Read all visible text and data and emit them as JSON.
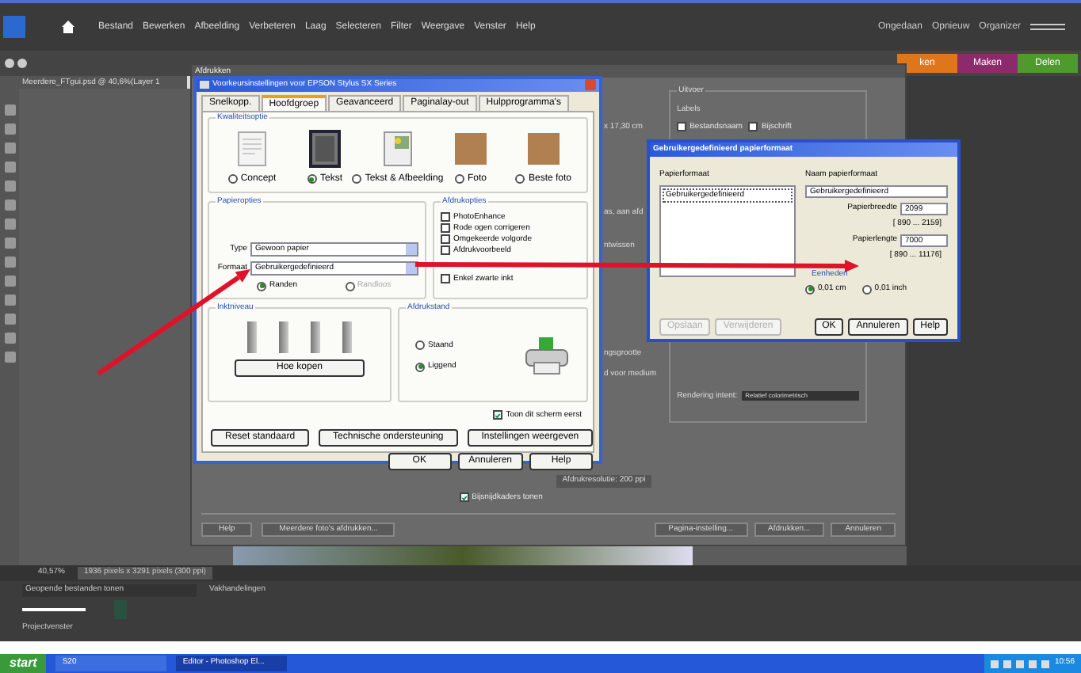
{
  "menu_bar": {
    "items": [
      "Bestand",
      "Bewerken",
      "Afbeelding",
      "Verbeteren",
      "Laag",
      "Selecteren",
      "Filter",
      "Weergave",
      "Venster",
      "Help"
    ],
    "right_buttons": [
      "Ongedaan",
      "Opnieuw",
      "Organizer"
    ]
  },
  "document_tab": "Meerdere_FTgui.psd @ 40,6%(Layer 1",
  "panel_tabs": [
    {
      "label": "ken",
      "color": "#e0761c"
    },
    {
      "label": "Maken",
      "color": "#8c2a6c"
    },
    {
      "label": "Delen",
      "color": "#4f9a2c"
    }
  ],
  "print_dialog": {
    "title": "Afdrukken",
    "cut_labels": [
      "x 17,30 cm",
      "as, aan afd",
      "ntwissen",
      "ngsgrootte",
      "d voor medium"
    ],
    "resolution": "Afdrukresolutie: 200 ppi",
    "crop_marks": {
      "label": "Bijsnijdkaders tonen",
      "checked": true
    },
    "output": {
      "title": "Uitvoer",
      "labels_title": "Labels",
      "options": [
        {
          "label": "Bestandsnaam",
          "checked": false
        },
        {
          "label": "Bijschrift",
          "checked": false
        }
      ],
      "rendering_label": "Rendering intent:",
      "rendering_value": "Relatief colorimetrisch"
    },
    "buttons_left": [
      "Help",
      "Meerdere foto's afdrukken..."
    ],
    "buttons_right": [
      "Pagina-instelling...",
      "Afdrukken...",
      "Annuleren"
    ]
  },
  "printer_dialog": {
    "title": "Voorkeursinstellingen voor EPSON Stylus SX Series",
    "tabs": [
      {
        "label": "Snelkopp.",
        "selected": false
      },
      {
        "label": "Hoofdgroep",
        "selected": true
      },
      {
        "label": "Geavanceerd",
        "selected": false
      },
      {
        "label": "Paginalay-out",
        "selected": false
      },
      {
        "label": "Hulpprogramma's",
        "selected": false
      }
    ],
    "quality": {
      "title": "Kwaliteitsoptie",
      "options": [
        {
          "label": "Concept",
          "kind": "document",
          "selected": false
        },
        {
          "label": "Tekst",
          "kind": "text",
          "selected": true
        },
        {
          "label": "Tekst & Afbeelding",
          "kind": "mixed",
          "selected": false
        },
        {
          "label": "Foto",
          "kind": "photo",
          "selected": false
        },
        {
          "label": "Beste foto",
          "kind": "photo",
          "selected": false
        }
      ]
    },
    "paper": {
      "title": "Papieropties",
      "type_label": "Type",
      "type_value": "Gewoon papier",
      "size_label": "Formaat",
      "size_value": "Gebruikergedefinieerd",
      "borders": [
        {
          "label": "Randen",
          "selected": true,
          "disabled": false
        },
        {
          "label": "Randloos",
          "selected": false,
          "disabled": true
        }
      ]
    },
    "print_options": {
      "title": "Afdrukopties",
      "options": [
        {
          "label": "PhotoEnhance",
          "checked": false
        },
        {
          "label": "Rode ogen corrigeren",
          "checked": false
        },
        {
          "label": "Omgekeerde volgorde",
          "checked": false
        },
        {
          "label": "Afdrukvoorbeeld",
          "checked": false
        },
        {
          "label": "Enkel zwarte inkt",
          "checked": false
        }
      ]
    },
    "ink": {
      "title": "Inktniveau",
      "buy_button": "Hoe kopen"
    },
    "orientation": {
      "title": "Afdrukstand",
      "options": [
        {
          "label": "Staand",
          "selected": false
        },
        {
          "label": "Liggend",
          "selected": true
        }
      ]
    },
    "show_first": {
      "label": "Toon dit scherm eerst",
      "checked": true
    },
    "buttons_row": [
      "Reset standaard",
      "Technische ondersteuning",
      "Instellingen weergeven"
    ],
    "footer_buttons": [
      "OK",
      "Annuleren",
      "Help"
    ]
  },
  "paper_dialog": {
    "title": "Gebruikergedefinieerd papierformaat",
    "list_label": "Papierformaat",
    "list_items": [
      {
        "label": "Gebruikergedefinieerd",
        "selected": true
      }
    ],
    "name_label": "Naam papierformaat",
    "name_value": "Gebruikergedefinieerd",
    "width": {
      "label": "Papierbreedte",
      "value": "2099",
      "range": "[ 890 ... 2159]"
    },
    "length": {
      "label": "Papierlengte",
      "value": "7000",
      "range": "[ 890 ... 11176]"
    },
    "units": {
      "title": "Eenheden",
      "options": [
        {
          "label": "0,01 cm",
          "selected": true
        },
        {
          "label": "0,01 inch",
          "selected": false
        }
      ]
    },
    "buttons": [
      {
        "label": "Opslaan",
        "disabled": true
      },
      {
        "label": "Verwijderen",
        "disabled": true
      },
      {
        "label": "OK",
        "disabled": false
      },
      {
        "label": "Annuleren",
        "disabled": false
      },
      {
        "label": "Help",
        "disabled": false
      }
    ]
  },
  "status_bar": {
    "zoom": "40,57%",
    "info": "1936 pixels x 3291 pixels (300 ppi)"
  },
  "project_bin": {
    "dropdown": "Geopende bestanden tonen",
    "menu": "Vakhandelingen",
    "title": "Projectvenster"
  },
  "taskbar": {
    "start": "start",
    "items": [
      {
        "label": "S20",
        "selected": false
      },
      {
        "label": "Editor - Photoshop El...",
        "selected": true
      }
    ],
    "clock": "10:56"
  }
}
